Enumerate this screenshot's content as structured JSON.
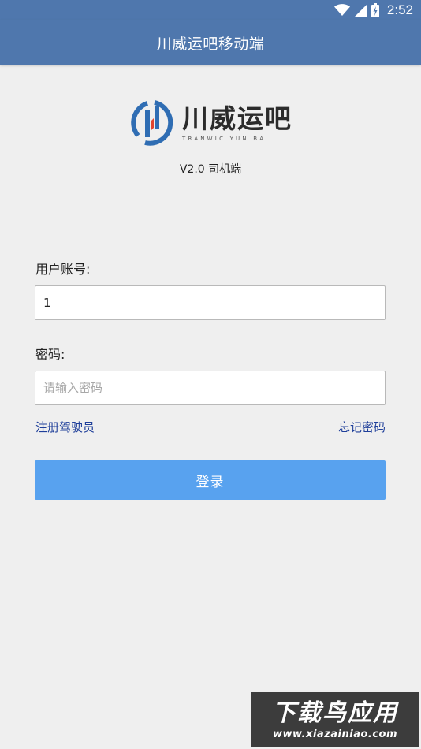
{
  "status_bar": {
    "time": "2:52",
    "icons": [
      "wifi-icon",
      "cell-signal-icon",
      "battery-charging-icon"
    ]
  },
  "app_bar": {
    "title": "川威运吧移动端"
  },
  "logo": {
    "cn_text": "川威运吧",
    "en_text": "TRANWIC YUN BA"
  },
  "version_text": "V2.0 司机端",
  "form": {
    "account_label": "用户账号:",
    "account_value": "1",
    "password_label": "密码:",
    "password_placeholder": "请输入密码",
    "register_link": "注册驾驶员",
    "forgot_link": "忘记密码",
    "login_button": "登录"
  },
  "watermark": {
    "title": "下载鸟应用",
    "url": "www.xiazainiao.com"
  },
  "colors": {
    "primary_bar": "#4f77ad",
    "login_button": "#58a2ef",
    "link": "#1f3f9a",
    "background": "#efefef",
    "logo_blue": "#2f6db3",
    "logo_red": "#e2452f"
  }
}
